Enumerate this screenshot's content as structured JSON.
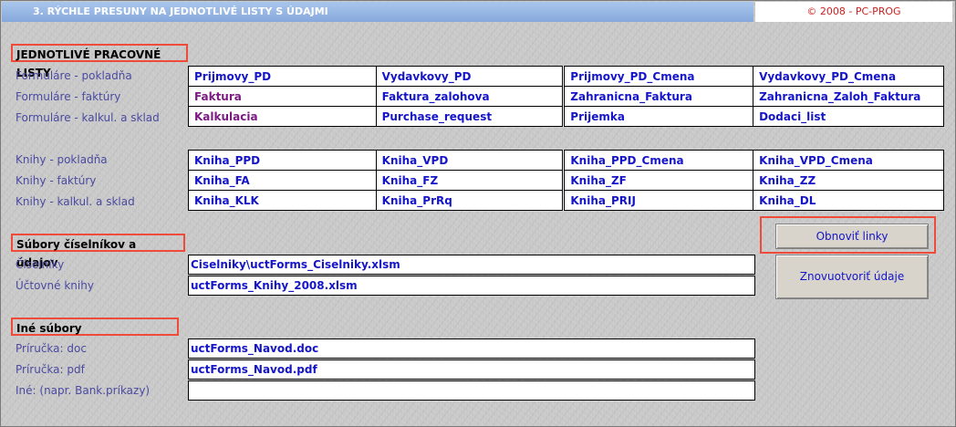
{
  "header": {
    "title": "3. RÝCHLE PRESUNY NA JEDNOTLIVÉ LISTY S  ÚDAJMI",
    "copyright": "© 2008 - PC-PROG"
  },
  "sheets": {
    "title": "JEDNOTLIVÉ PRACOVNÉ LISTY",
    "forms": [
      {
        "label": "Formuláre - pokladňa",
        "links": [
          "Prijmovy_PD",
          "Vydavkovy_PD",
          "Prijmovy_PD_Cmena",
          "Vydavkovy_PD_Cmena"
        ]
      },
      {
        "label": "Formuláre - faktúry",
        "links": [
          "Faktura",
          "Faktura_zalohova",
          "Zahranicna_Faktura",
          "Zahranicna_Zaloh_Faktura"
        ]
      },
      {
        "label": "Formuláre - kalkul. a sklad",
        "links": [
          "Kalkulacia",
          "Purchase_request",
          "Prijemka",
          "Dodaci_list"
        ]
      }
    ],
    "books": [
      {
        "label": "Knihy - pokladňa",
        "links": [
          "Kniha_PPD",
          "Kniha_VPD",
          "Kniha_PPD_Cmena",
          "Kniha_VPD_Cmena"
        ]
      },
      {
        "label": "Knihy - faktúry",
        "links": [
          "Kniha_FA",
          "Kniha_FZ",
          "Kniha_ZF",
          "Kniha_ZZ"
        ]
      },
      {
        "label": "Knihy - kalkul. a sklad",
        "links": [
          "Kniha_KLK",
          "Kniha_PrRq",
          "Kniha_PRIJ",
          "Kniha_DL"
        ]
      }
    ]
  },
  "catalogs": {
    "title": "Súbory číselníkov a údajov",
    "rows": [
      {
        "label": "Číselníky",
        "value": "Ciselniky\\uctForms_Ciselniky.xlsm"
      },
      {
        "label": "Účtovné knihy",
        "value": "uctForms_Knihy_2008.xlsm"
      }
    ]
  },
  "other": {
    "title": "Iné súbory",
    "rows": [
      {
        "label": "Príručka: doc",
        "value": "uctForms_Navod.doc"
      },
      {
        "label": "Príručka: pdf",
        "value": "uctForms_Navod.pdf"
      },
      {
        "label": "Iné: (napr. Bank.príkazy)",
        "value": ""
      }
    ]
  },
  "buttons": {
    "refresh_links": "Obnoviť linky",
    "reopen_data": "Znovuotvoriť údaje"
  },
  "colors": {
    "title_bar": "#86a8db",
    "link": "#1515c8",
    "link_visited": "#7a1a82",
    "label": "#4a4aa0",
    "highlight": "#ef4a3a"
  }
}
